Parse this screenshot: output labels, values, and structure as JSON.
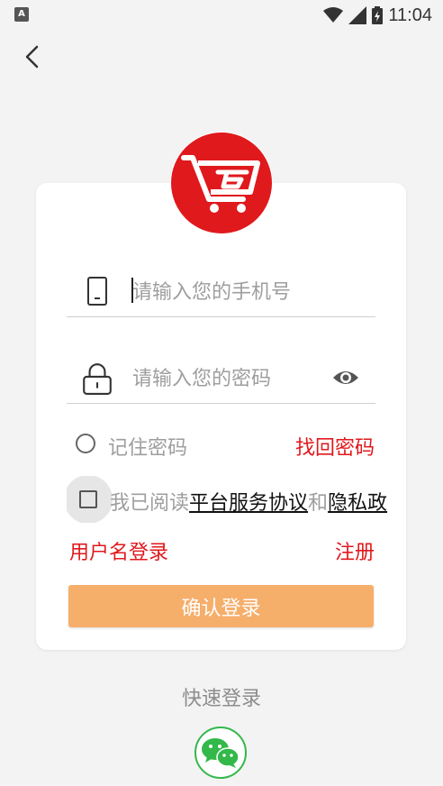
{
  "status_bar": {
    "app_icon_letter": "A",
    "time": "11:04"
  },
  "login": {
    "phone_placeholder": "请输入您的手机号",
    "password_placeholder": "请输入您的密码",
    "remember_label": "记住密码",
    "forgot_password": "找回密码",
    "agree_prefix": "我已阅读",
    "agreement_link": "平台服务协议",
    "agree_and": "和",
    "privacy_link": "隐私政",
    "username_login": "用户名登录",
    "register": "注册",
    "confirm_button": "确认登录",
    "quick_login": "快速登录"
  },
  "colors": {
    "brand_red": "#e0191d",
    "button_orange": "#f6ae6b",
    "wechat_green": "#33b84a"
  }
}
